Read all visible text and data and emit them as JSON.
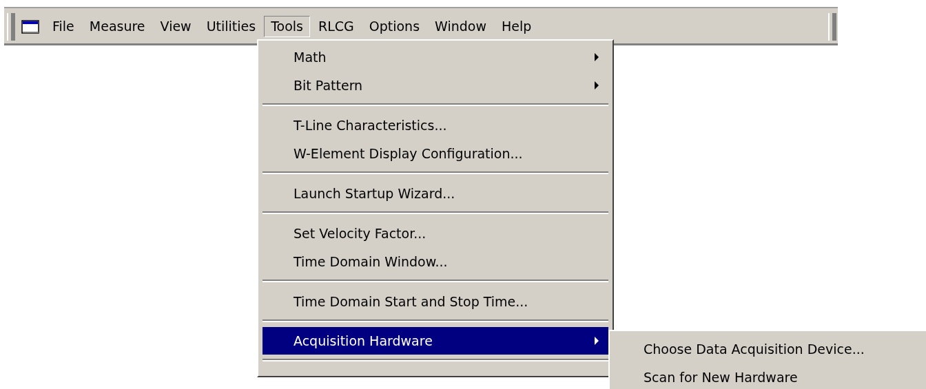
{
  "menu_bar": {
    "items": [
      {
        "label": "File",
        "selected": false
      },
      {
        "label": "Measure",
        "selected": false
      },
      {
        "label": "View",
        "selected": false
      },
      {
        "label": "Utilities",
        "selected": false
      },
      {
        "label": "Tools",
        "selected": true
      },
      {
        "label": "RLCG",
        "selected": false
      },
      {
        "label": "Options",
        "selected": false
      },
      {
        "label": "Window",
        "selected": false
      },
      {
        "label": "Help",
        "selected": false
      }
    ]
  },
  "tools_menu": {
    "items": [
      {
        "kind": "item",
        "label": "Math",
        "has_submenu": true,
        "selected": false
      },
      {
        "kind": "item",
        "label": "Bit Pattern",
        "has_submenu": true,
        "selected": false
      },
      {
        "kind": "separator"
      },
      {
        "kind": "item",
        "label": "T-Line Characteristics...",
        "has_submenu": false,
        "selected": false
      },
      {
        "kind": "item",
        "label": "W-Element Display Configuration...",
        "has_submenu": false,
        "selected": false
      },
      {
        "kind": "separator"
      },
      {
        "kind": "item",
        "label": "Launch Startup Wizard...",
        "has_submenu": false,
        "selected": false
      },
      {
        "kind": "separator"
      },
      {
        "kind": "item",
        "label": "Set Velocity Factor...",
        "has_submenu": false,
        "selected": false
      },
      {
        "kind": "item",
        "label": "Time Domain Window...",
        "has_submenu": false,
        "selected": false
      },
      {
        "kind": "separator"
      },
      {
        "kind": "item",
        "label": "Time Domain Start and Stop Time...",
        "has_submenu": false,
        "selected": false
      },
      {
        "kind": "separator"
      },
      {
        "kind": "item",
        "label": "Acquisition Hardware",
        "has_submenu": true,
        "selected": true
      },
      {
        "kind": "separator"
      }
    ]
  },
  "submenu": {
    "items": [
      {
        "kind": "item",
        "label": "Choose Data Acquisition Device...",
        "selected": false
      },
      {
        "kind": "item",
        "label": "Scan for New Hardware",
        "selected": false
      }
    ]
  }
}
